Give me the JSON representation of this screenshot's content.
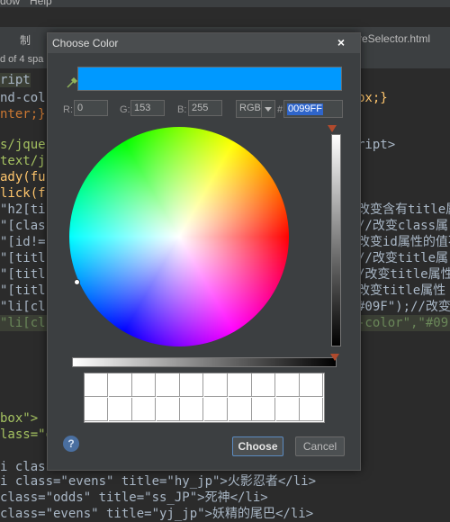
{
  "menubar": {
    "items": [
      "dow",
      "Help"
    ]
  },
  "tabbar": {
    "left_tab": "制",
    "right_tab": "reSelector.html"
  },
  "infobar": {
    "text": "d of 4 spa"
  },
  "code_lines": [
    {
      "a": "ript"
    },
    {
      "a": "nd-col",
      "b": "px;}"
    },
    {
      "a": "nter;}"
    },
    {
      "a": "s/jque",
      "b": "ript>"
    },
    {
      "a": "text/j"
    },
    {
      "a": "ady(fu"
    },
    {
      "a": "lick(f"
    },
    {
      "a": "\"h2[ti",
      "b": "改变含有title属"
    },
    {
      "a": "\"[clas",
      "b": "//改变class属"
    },
    {
      "a": "\"[id!=",
      "b": "改变id属性的值不"
    },
    {
      "a": "\"[titl",
      "b": "//改变title属"
    },
    {
      "a": "\"[titl",
      "b": "/改变title属性"
    },
    {
      "a": "\"[titl",
      "b": "改变title属性"
    },
    {
      "a": "\"li[cl",
      "b": "#09F\");//改变"
    },
    {
      "a": "\"li[cl",
      "b": "-color\",\"#09"
    },
    {
      "a": "box\">"
    },
    {
      "a": "lass=\"o"
    },
    {
      "a": "i class"
    },
    {
      "a": "i class=\"evens\" title=\"hy_jp\">火影忍者</li>"
    },
    {
      "a": "class=\"odds\" title=\"ss_JP\">死神</li>"
    },
    {
      "a": "class=\"evens\" title=\"yj_jp\">妖精的尾巴</li>"
    }
  ],
  "dialog": {
    "title": "Choose Color",
    "preview_color": "#0099FF",
    "r_label": "R:",
    "r_value": "0",
    "g_label": "G:",
    "g_value": "153",
    "b_label": "B:",
    "b_value": "255",
    "mode": "RGB",
    "hash": "#",
    "hex_value": "0099FF",
    "brightness": 1.0,
    "opacity": 1.0,
    "swatch_colors": [
      "#ffffff",
      "#ffffff",
      "#ffffff",
      "#ffffff",
      "#ffffff",
      "#ffffff",
      "#ffffff",
      "#ffffff",
      "#ffffff",
      "#ffffff",
      "#ffffff",
      "#ffffff",
      "#ffffff",
      "#ffffff",
      "#ffffff",
      "#ffffff",
      "#ffffff",
      "#ffffff",
      "#ffffff",
      "#ffffff"
    ],
    "help": "?",
    "choose_label": "Choose",
    "cancel_label": "Cancel"
  },
  "icons": {
    "close": "close-icon",
    "picker": "color-picker-icon",
    "dropdown": "chevron-down-icon",
    "help": "help-icon"
  }
}
